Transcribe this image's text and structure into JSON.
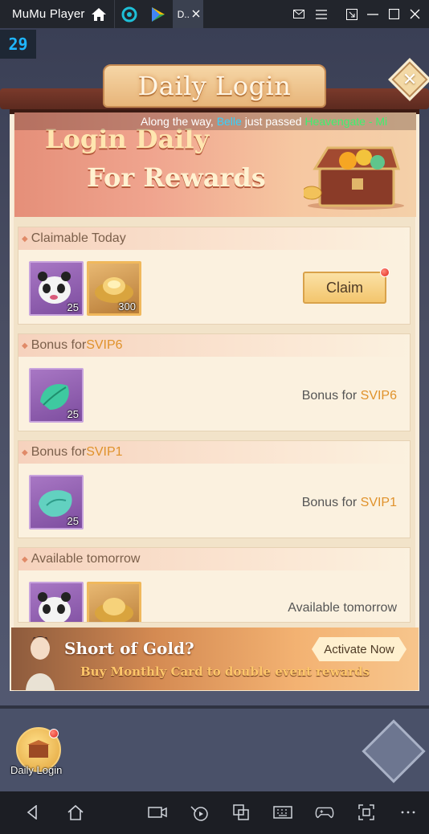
{
  "emulator": {
    "app_title": "MuMu Player",
    "active_tab_label": "D..",
    "fps": "29"
  },
  "dialog": {
    "title": "Daily Login"
  },
  "banner": {
    "ticker_prefix": "Along the way, ",
    "ticker_name": "Belle",
    "ticker_mid": " just passed ",
    "ticker_place": "Heavengate - Mi",
    "title_line1": "Login Daily",
    "title_line2": "For Rewards"
  },
  "sections": {
    "claimable": {
      "header": "Claimable Today",
      "items": [
        {
          "icon": "panda-icon",
          "qty": "25"
        },
        {
          "icon": "gold-ingot-icon",
          "qty": "300"
        }
      ],
      "button": "Claim"
    },
    "svip6": {
      "header_prefix": "Bonus for ",
      "header_highlight": "SVIP6",
      "items": [
        {
          "icon": "jade-leaf-icon",
          "qty": "25"
        }
      ],
      "status_prefix": "Bonus for ",
      "status_highlight": "SVIP6"
    },
    "svip1": {
      "header_prefix": "Bonus for ",
      "header_highlight": "SVIP1",
      "items": [
        {
          "icon": "jade-stone-icon",
          "qty": "25"
        }
      ],
      "status_prefix": "Bonus for ",
      "status_highlight": "SVIP1"
    },
    "tomorrow": {
      "header": "Available tomorrow",
      "items": [
        {
          "icon": "panda-icon"
        },
        {
          "icon": "gold-ingot-icon"
        }
      ],
      "status": "Available tomorrow"
    }
  },
  "promo": {
    "title": "Short of Gold?",
    "subtitle": "Buy Monthly Card to double event rewards",
    "button": "Activate Now"
  },
  "hud": {
    "daily_login_label": "Daily Login"
  },
  "colors": {
    "highlight": "#e0922b",
    "ticker_name": "#33d1ff",
    "ticker_place": "#3cf26f"
  }
}
